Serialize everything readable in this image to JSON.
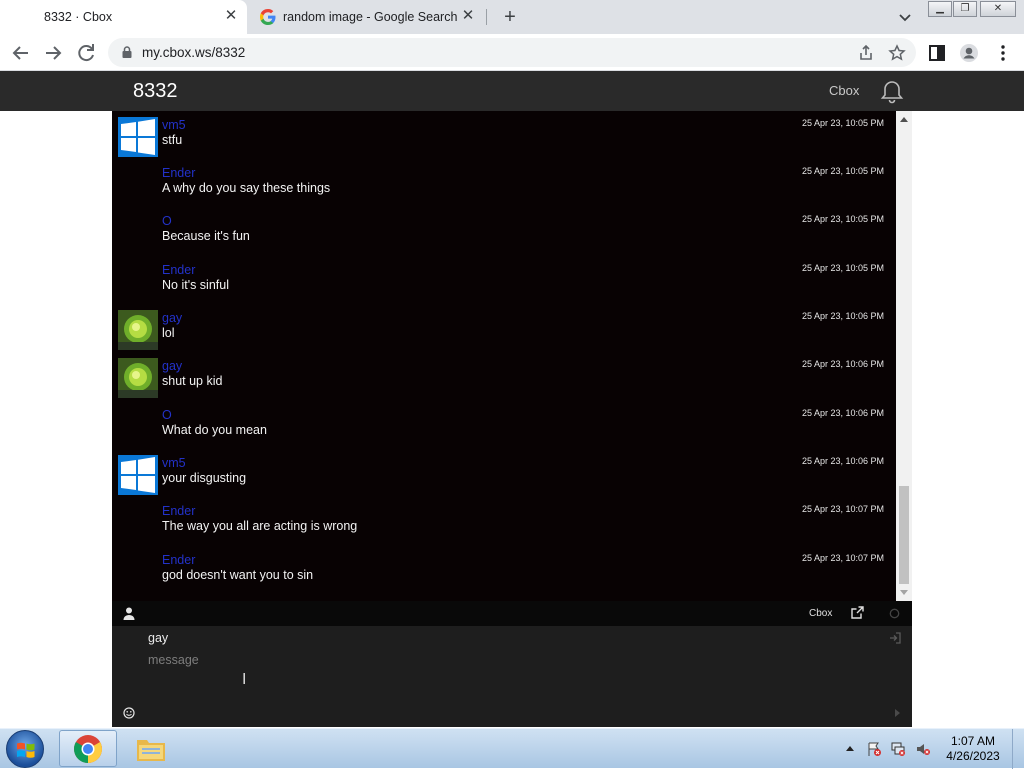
{
  "browser": {
    "tabs": [
      {
        "title": "8332 · Cbox",
        "active": true,
        "favicon": "cbox-icon"
      },
      {
        "title": "random image - Google Search",
        "active": false,
        "favicon": "google-icon"
      }
    ],
    "url": "my.cbox.ws/8332"
  },
  "cbox": {
    "room_title": "8332",
    "brand_label": "Cbox",
    "footer_brand": "Cbox",
    "messages": [
      {
        "name": "vm5",
        "text": "stfu",
        "time": "25 Apr 23, 10:05 PM",
        "avatar": "windows-logo-avatar"
      },
      {
        "name": "Ender",
        "text": "A why do you say these things",
        "time": "25 Apr 23, 10:05 PM",
        "avatar": ""
      },
      {
        "name": "O",
        "text": "Because it's fun",
        "time": "25 Apr 23, 10:05 PM",
        "avatar": ""
      },
      {
        "name": "Ender",
        "text": "No it's sinful",
        "time": "25 Apr 23, 10:05 PM",
        "avatar": ""
      },
      {
        "name": "gay",
        "text": "lol",
        "time": "25 Apr 23, 10:06 PM",
        "avatar": "green-photo-avatar"
      },
      {
        "name": "gay",
        "text": "shut up kid",
        "time": "25 Apr 23, 10:06 PM",
        "avatar": "green-photo-avatar"
      },
      {
        "name": "O",
        "text": "What do you mean",
        "time": "25 Apr 23, 10:06 PM",
        "avatar": ""
      },
      {
        "name": "vm5",
        "text": "your disgusting",
        "time": "25 Apr 23, 10:06 PM",
        "avatar": "windows-logo-avatar"
      },
      {
        "name": "Ender",
        "text": "The way you all are acting is wrong",
        "time": "25 Apr 23, 10:07 PM",
        "avatar": ""
      },
      {
        "name": "Ender",
        "text": "god doesn't want you to sin",
        "time": "25 Apr 23, 10:07 PM",
        "avatar": ""
      }
    ],
    "input": {
      "name_value": "gay",
      "message_placeholder": "message"
    }
  },
  "taskbar": {
    "time": "1:07 AM",
    "date": "4/26/2023"
  },
  "colors": {
    "chat_background": "#080203",
    "username": "#2332c9",
    "message_text": "#f3f3f3",
    "header": "#2a2a2a"
  }
}
